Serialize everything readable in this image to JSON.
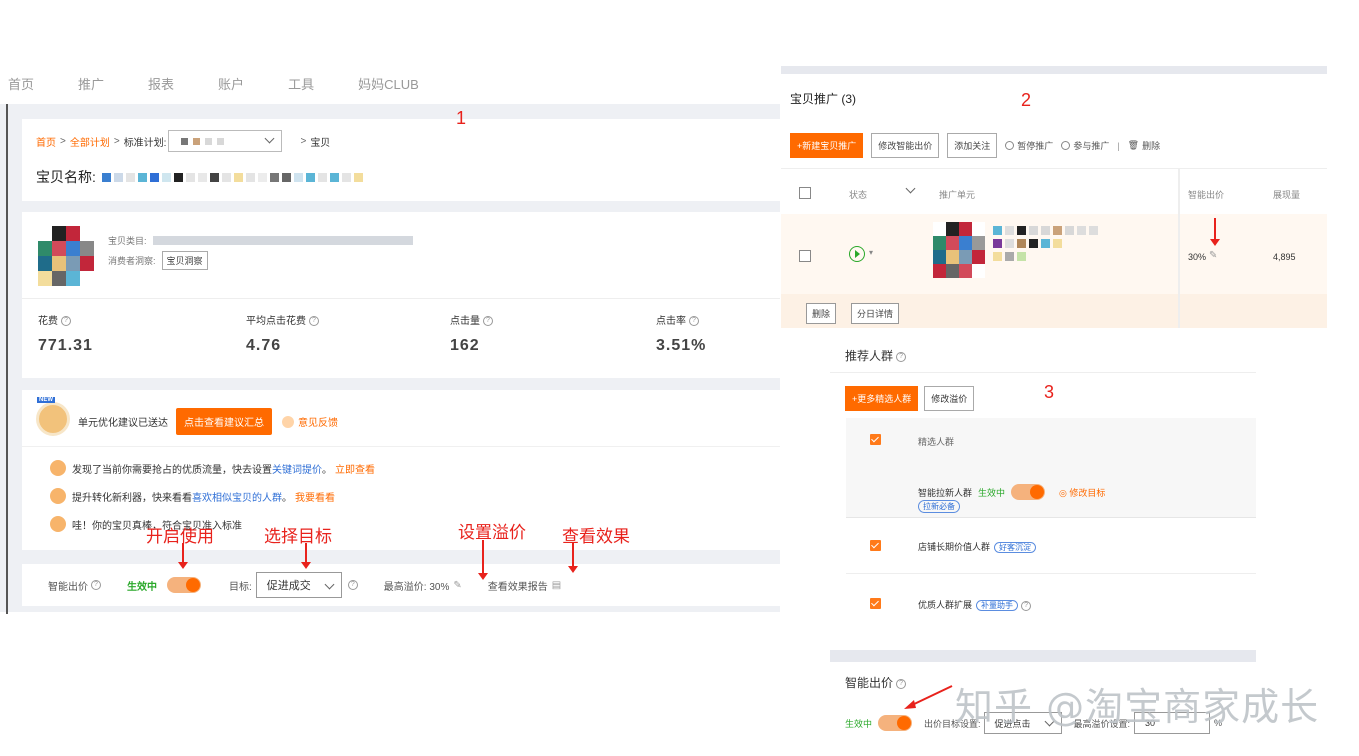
{
  "left": {
    "nav": [
      "首页",
      "推广",
      "报表",
      "账户",
      "工具",
      "妈妈CLUB"
    ],
    "breadcrumb": {
      "home": "首页",
      "all_plans": "全部计划",
      "std_plan": "标准计划:",
      "item": "宝贝",
      "sep": ">"
    },
    "item_name_label": "宝贝名称:",
    "info": {
      "category_label": "宝贝类目:",
      "insight_label": "消费者洞察:",
      "insight_btn": "宝贝洞察"
    },
    "metrics": [
      {
        "label": "花费",
        "value": "771.31"
      },
      {
        "label": "平均点击花费",
        "value": "4.76"
      },
      {
        "label": "点击量",
        "value": "162"
      },
      {
        "label": "点击率",
        "value": "3.51%"
      }
    ],
    "suggest": {
      "new_badge": "NEW",
      "sent_text": "单元优化建议已送达",
      "view_btn": "点击查看建议汇总",
      "feedback": "意见反馈",
      "tips": [
        {
          "pre": "发现了当前你需要抢占的优质流量，快去设置",
          "blue": "关键词提价",
          "mid": "。",
          "orange": "立即查看"
        },
        {
          "pre": "提升转化新利器，快来看看",
          "blue": "喜欢相似宝贝的人群",
          "mid": "。",
          "orange": "我要看看"
        },
        {
          "pre": "哇！你的宝贝真棒，符合",
          "blue": "",
          "mid": "宝贝准入标准",
          "orange": ""
        }
      ]
    },
    "bid": {
      "label": "智能出价",
      "status": "生效中",
      "target_label": "目标:",
      "target_value": "促进成交",
      "max_premium": "最高溢价: 30%",
      "report": "查看效果报告"
    },
    "annotations": {
      "num1": "1",
      "enable": "开启使用",
      "choose": "选择目标",
      "premium": "设置溢价",
      "effect": "查看效果"
    }
  },
  "right": {
    "title": "宝贝推广 (3)",
    "num2": "2",
    "buttons": {
      "new": "+新建宝贝推广",
      "modify": "修改智能出价",
      "follow": "添加关注",
      "pause": "暂停推广",
      "join": "参与推广",
      "sep": "|",
      "delete": "删除"
    },
    "table": {
      "headers": {
        "status": "状态",
        "unit": "推广单元",
        "smart_bid": "智能出价",
        "impressions": "展现量"
      },
      "row": {
        "bid": "30%",
        "impressions": "4,895"
      },
      "foot": {
        "delete": "删除",
        "daily": "分日详情"
      }
    }
  },
  "crowd": {
    "title": "推荐人群",
    "num3": "3",
    "buttons": {
      "more": "+更多精选人群",
      "modify": "修改溢价"
    },
    "header": "精选人群",
    "smart": {
      "name": "智能拉新人群",
      "status": "生效中",
      "modify": "修改目标",
      "tag": "拉新必备"
    },
    "rows": [
      {
        "name": "店铺长期价值人群",
        "tag": "好客沉淀"
      },
      {
        "name": "优质人群扩展",
        "tag": "补量助手"
      }
    ]
  },
  "smartbid": {
    "title": "智能出价",
    "status": "生效中",
    "target_label": "出价目标设置:",
    "target_value": "促进点击",
    "max_label": "最高溢价设置:",
    "max_value": "30",
    "unit": "%"
  },
  "watermark": "知乎 @淘宝商家成长",
  "colors": {
    "accent": "#ff6a00",
    "green": "#2aa82a",
    "annotation": "#e8221c",
    "link": "#2f6fd6"
  }
}
